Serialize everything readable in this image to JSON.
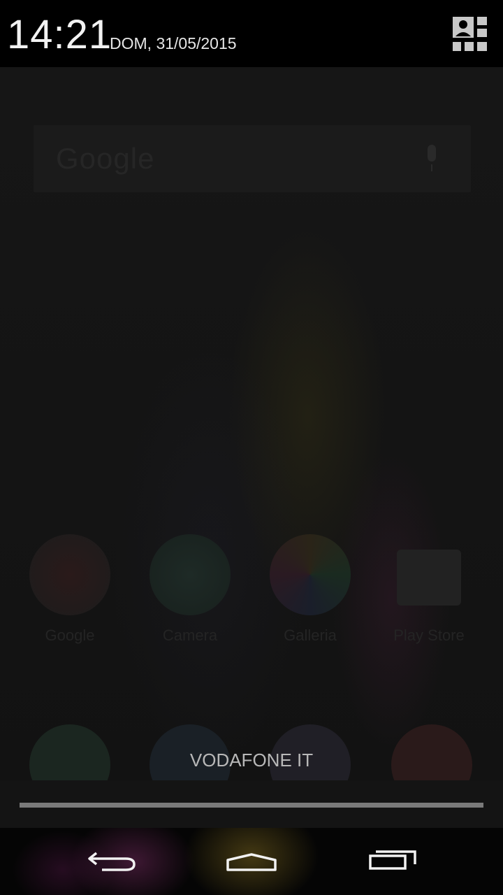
{
  "status": {
    "time": "14:21",
    "date": "DOM, 31/05/2015"
  },
  "home": {
    "search_logo": "Google",
    "apps": [
      {
        "label": "Google",
        "icon": "google-folder-icon"
      },
      {
        "label": "Camera",
        "icon": "camera-icon"
      },
      {
        "label": "Galleria",
        "icon": "gallery-icon"
      },
      {
        "label": "Play Store",
        "icon": "play-store-icon"
      }
    ],
    "dock": [
      "phone-icon",
      "contacts-icon",
      "email-icon",
      "people-icon"
    ]
  },
  "shade": {
    "carrier": "VODAFONE IT"
  },
  "nav": [
    "back-icon",
    "home-icon",
    "recents-icon"
  ],
  "colors": {
    "header_bg": "#000000",
    "text_primary": "#f2f2f2",
    "carrier_text": "#b8b8b8",
    "handle": "#7a7a7a"
  }
}
